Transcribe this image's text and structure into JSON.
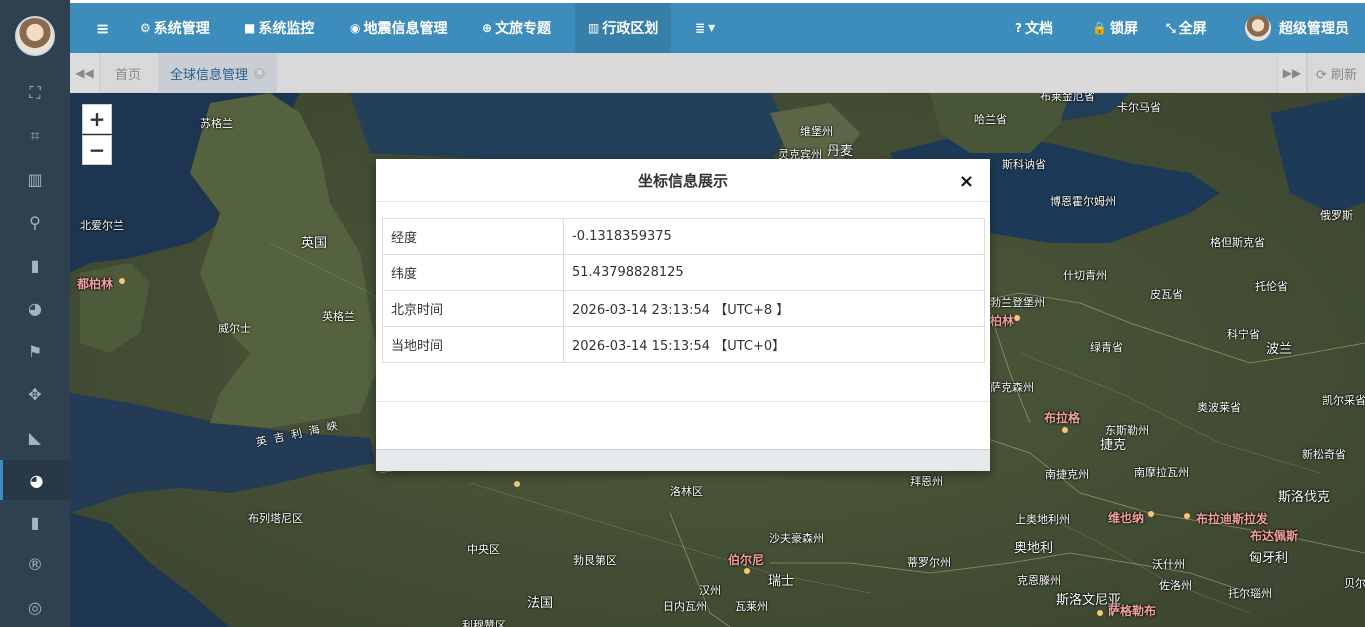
{
  "sidebar": {
    "icons": [
      {
        "name": "dashboard-icon",
        "glyph": "⛶"
      },
      {
        "name": "sitemap-icon",
        "glyph": "⌗"
      },
      {
        "name": "map-icon",
        "glyph": "▥"
      },
      {
        "name": "map-marker-icon",
        "glyph": "⚲"
      },
      {
        "name": "bar-chart-icon",
        "glyph": "▮"
      },
      {
        "name": "globe-icon",
        "glyph": "◕"
      },
      {
        "name": "flag-icon",
        "glyph": "⚑"
      },
      {
        "name": "arrows-icon",
        "glyph": "✥"
      },
      {
        "name": "area-chart-icon",
        "glyph": "◣"
      },
      {
        "name": "globe-active-icon",
        "glyph": "◕"
      },
      {
        "name": "stats-icon",
        "glyph": "▮"
      },
      {
        "name": "registered-icon",
        "glyph": "®"
      },
      {
        "name": "life-ring-icon",
        "glyph": "◎"
      }
    ]
  },
  "navbar": {
    "menu_toggle": "≡",
    "items": [
      {
        "icon": "⚙",
        "label": "系统管理"
      },
      {
        "icon": "■",
        "label": "系统监控"
      },
      {
        "icon": "◉",
        "label": "地震信息管理"
      },
      {
        "icon": "⊕",
        "label": "文旅专题"
      },
      {
        "icon": "▥",
        "label": "行政区划"
      },
      {
        "icon": "≣",
        "label": "▾"
      }
    ],
    "right": [
      {
        "icon": "?",
        "label": "文档"
      },
      {
        "icon": "🔒",
        "label": "锁屏"
      },
      {
        "icon": "⤡",
        "label": "全屏"
      }
    ],
    "user": "超级管理员"
  },
  "tabs": {
    "prev": "◀◀",
    "home": "首页",
    "active": "全球信息管理",
    "close": "×",
    "next": "▶▶",
    "refresh": "⟳ 刷新"
  },
  "map": {
    "zoom_in": "+",
    "zoom_out": "−",
    "labels": [
      "苏格兰",
      "北爱尔兰",
      "英国",
      "都柏林",
      "威尔士",
      "英格兰",
      "英吉利海峡",
      "布列塔尼区",
      "中央区",
      "勃艮第区",
      "法国",
      "洛林区",
      "日内瓦州",
      "利穆赞区",
      "维堡州",
      "灵克宾州",
      "丹麦",
      "哈兰省",
      "斯科讷省",
      "卡尔马省",
      "布莱金厄省",
      "博恩霍尔姆州",
      "格但斯克省",
      "俄罗斯",
      "什切青州",
      "波兰",
      "托伦省",
      "皮瓦省",
      "科宁省",
      "绿青省",
      "东斯勒州",
      "奥波莱省",
      "布拉格",
      "捷克",
      "南捷克州",
      "南摩拉瓦州",
      "斯洛伐克",
      "凯尔采省",
      "新松奇省",
      "拜恩州",
      "沙夫豪森州",
      "蒂罗尔州",
      "上奥地利州",
      "奥地利",
      "维也纳",
      "布拉迪斯拉发",
      "布达佩斯",
      "匈牙利",
      "斯洛文尼亚",
      "克恩滕州",
      "萨格勒布",
      "沃什州",
      "佐洛州",
      "托尔瑙州",
      "贝尔",
      "瑞士",
      "伯尔尼",
      "汉州",
      "瓦莱州",
      "萨克森州",
      "勃兰登堡州",
      "柏林"
    ]
  },
  "modal": {
    "title": "坐标信息展示",
    "close": "×",
    "rows": [
      {
        "key": "经度",
        "value": "-0.1318359375"
      },
      {
        "key": "纬度",
        "value": "51.43798828125"
      },
      {
        "key": "北京时间",
        "value": "2026-03-14 23:13:54 【UTC+8 】"
      },
      {
        "key": "当地时间",
        "value": "2026-03-14 15:13:54 【UTC+0】"
      }
    ]
  }
}
